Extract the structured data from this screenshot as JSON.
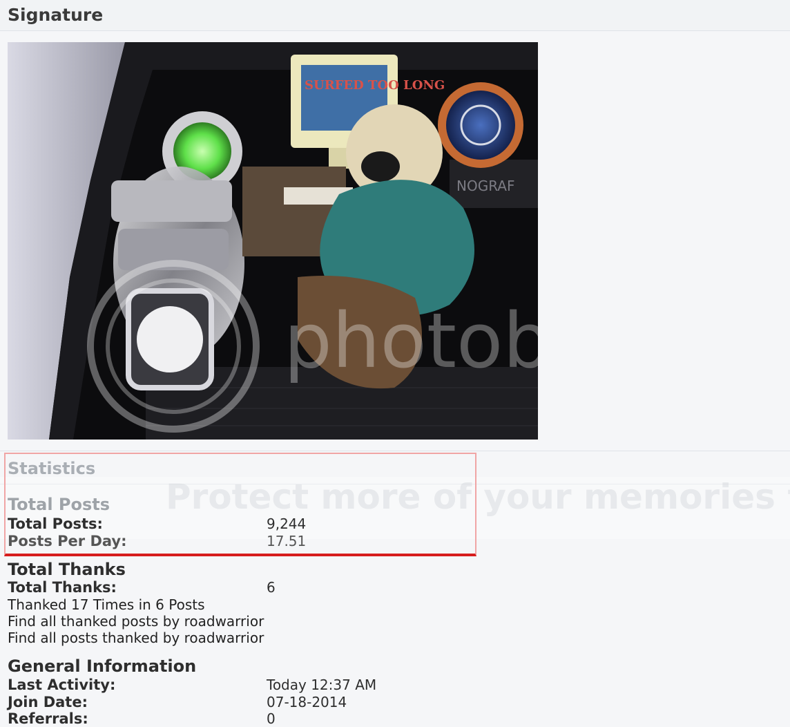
{
  "signature": {
    "title": "Signature",
    "image_watermark": "photobucket",
    "image_monitor_text": "SURFED TOO LONG",
    "image_box_text": "NOGRAF"
  },
  "overlay": {
    "text": "Protect more of your memories for less!"
  },
  "statistics": {
    "title": "Statistics",
    "total_posts": {
      "heading": "Total Posts",
      "total_posts_label": "Total Posts:",
      "total_posts_value": "9,244",
      "posts_per_day_label": "Posts Per Day:",
      "posts_per_day_value": "17.51"
    },
    "total_thanks": {
      "heading": "Total Thanks",
      "total_thanks_label": "Total Thanks:",
      "total_thanks_value": "6",
      "thanked_text": "Thanked 17 Times in 6 Posts",
      "find_thanked_link": "Find all thanked posts by roadwarrior",
      "find_posts_thanked_link": "Find all posts thanked by roadwarrior"
    },
    "general": {
      "heading": "General Information",
      "last_activity_label": "Last Activity:",
      "last_activity_value": "Today 12:37 AM",
      "join_date_label": "Join Date:",
      "join_date_value": "07-18-2014",
      "referrals_label": "Referrals:",
      "referrals_value": "0"
    }
  },
  "colors": {
    "highlight_border": "#d61d1d",
    "highlight_border_light": "#f0a5a5"
  }
}
